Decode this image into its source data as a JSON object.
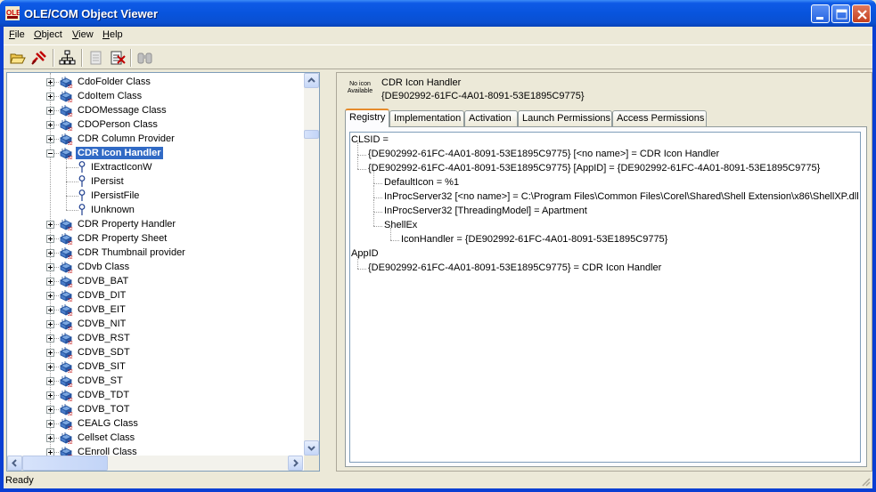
{
  "window": {
    "title": "OLE/COM Object Viewer"
  },
  "menu": [
    {
      "label": "File",
      "key": "F",
      "rest": "ile"
    },
    {
      "label": "Object",
      "key": "O",
      "rest": "bject"
    },
    {
      "label": "View",
      "key": "V",
      "rest": "iew"
    },
    {
      "label": "Help",
      "key": "H",
      "rest": "elp"
    }
  ],
  "tree": {
    "items": [
      {
        "label": "CdoFolder Class"
      },
      {
        "label": "CdoItem Class"
      },
      {
        "label": "CDOMessage Class"
      },
      {
        "label": "CDOPerson Class"
      },
      {
        "label": "CDR Column Provider"
      },
      {
        "label": "CDR Icon Handler",
        "selected": true
      },
      {
        "label": "IExtractIconW",
        "child": true
      },
      {
        "label": "IPersist",
        "child": true
      },
      {
        "label": "IPersistFile",
        "child": true
      },
      {
        "label": "IUnknown",
        "child": true
      },
      {
        "label": "CDR Property Handler"
      },
      {
        "label": "CDR Property Sheet"
      },
      {
        "label": "CDR Thumbnail provider"
      },
      {
        "label": "CDvb Class"
      },
      {
        "label": "CDVB_BAT"
      },
      {
        "label": "CDVB_DIT"
      },
      {
        "label": "CDVB_EIT"
      },
      {
        "label": "CDVB_NIT"
      },
      {
        "label": "CDVB_RST"
      },
      {
        "label": "CDVB_SDT"
      },
      {
        "label": "CDVB_SIT"
      },
      {
        "label": "CDVB_ST"
      },
      {
        "label": "CDVB_TDT"
      },
      {
        "label": "CDVB_TOT"
      },
      {
        "label": "CEALG Class"
      },
      {
        "label": "Cellset Class"
      },
      {
        "label": "CEnroll Class"
      }
    ]
  },
  "details": {
    "no_icon_line1": "No icon",
    "no_icon_line2": "Available",
    "name": "CDR Icon Handler",
    "clsid": "{DE902992-61FC-4A01-8091-53E1895C9775}"
  },
  "tabs": [
    {
      "label": "Registry",
      "active": true
    },
    {
      "label": "Implementation"
    },
    {
      "label": "Activation"
    },
    {
      "label": "Launch Permissions"
    },
    {
      "label": "Access Permissions"
    }
  ],
  "registry": [
    {
      "text": "CLSID =",
      "indent": 0
    },
    {
      "text": "{DE902992-61FC-4A01-8091-53E1895C9775} [<no name>] = CDR Icon Handler",
      "indent": 1
    },
    {
      "text": "{DE902992-61FC-4A01-8091-53E1895C9775} [AppID] = {DE902992-61FC-4A01-8091-53E1895C9775}",
      "indent": 1
    },
    {
      "text": "DefaultIcon = %1",
      "indent": 2
    },
    {
      "text": "InProcServer32 [<no name>] = C:\\Program Files\\Common Files\\Corel\\Shared\\Shell Extension\\x86\\ShellXP.dll",
      "indent": 2
    },
    {
      "text": "InProcServer32 [ThreadingModel] = Apartment",
      "indent": 2
    },
    {
      "text": "ShellEx",
      "indent": 2
    },
    {
      "text": "IconHandler = {DE902992-61FC-4A01-8091-53E1895C9775}",
      "indent": 3
    },
    {
      "text": "AppID",
      "indent": 0
    },
    {
      "text": "{DE902992-61FC-4A01-8091-53E1895C9775} = CDR Icon Handler",
      "indent": 1
    }
  ],
  "status": {
    "text": "Ready"
  }
}
